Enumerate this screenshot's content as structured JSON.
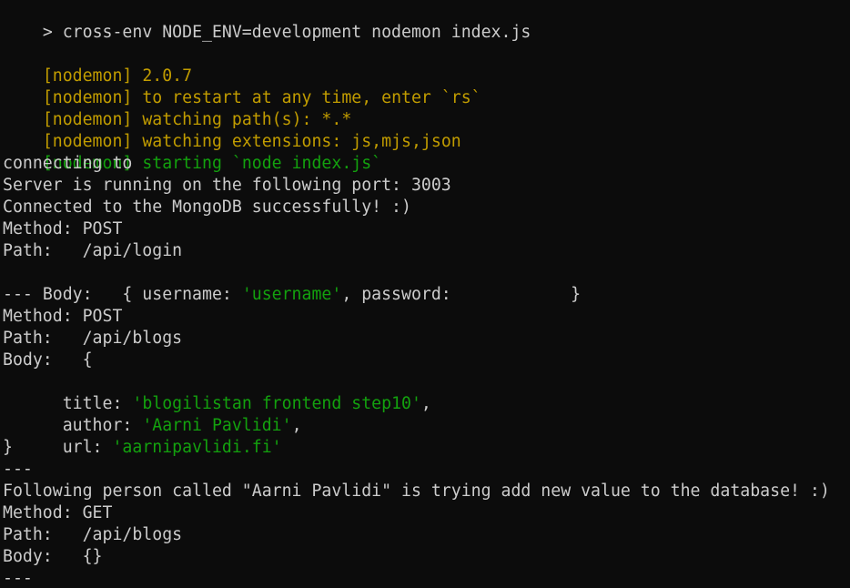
{
  "terminal": {
    "prompt_symbol": ">",
    "command": " cross-env NODE_ENV=development nodemon index.js",
    "nodemon_tag": "[nodemon]",
    "nodemon_version": " 2.0.7",
    "nodemon_restart": " to restart at any time, enter `rs`",
    "nodemon_watch_paths": " watching path(s): *.*",
    "nodemon_watch_ext": " watching extensions: js,mjs,json",
    "nodemon_starting": " starting `node index.js`",
    "log_connecting": "connecting to",
    "log_server_port": "Server is running on the following port: 3003",
    "log_connected": "Connected to the MongoDB successfully! :)",
    "req1": {
      "method_line": "Method: POST",
      "path_line": "Path:   /api/login",
      "body_prefix": "Body:   { username: ",
      "username_value": "'username'",
      "body_middle": ", password: ",
      "body_suffix": "           }",
      "separator": "---"
    },
    "req2": {
      "method_line": "Method: POST",
      "path_line": "Path:   /api/blogs",
      "body_open": "Body:   {",
      "title_key": "  title: ",
      "title_value": "'blogilistan frontend step10'",
      "title_comma": ",",
      "author_key": "  author: ",
      "author_value": "'Aarni Pavlidi'",
      "author_comma": ",",
      "url_key": "  url: ",
      "url_value": "'aarnipavlidi.fi'",
      "body_close": "}",
      "separator": "---"
    },
    "log_person": "Following person called \"Aarni Pavlidi\" is trying add new value to the database! :)",
    "req3": {
      "method_line": "Method: GET",
      "path_line": "Path:   /api/blogs",
      "body_line": "Body:   {}",
      "separator": "---"
    },
    "colors": {
      "background": "#0c0c0c",
      "text": "#cccccc",
      "nodemon_yellow": "#c19c00",
      "nodemon_green": "#13a10e",
      "string_green": "#13a10e"
    }
  }
}
